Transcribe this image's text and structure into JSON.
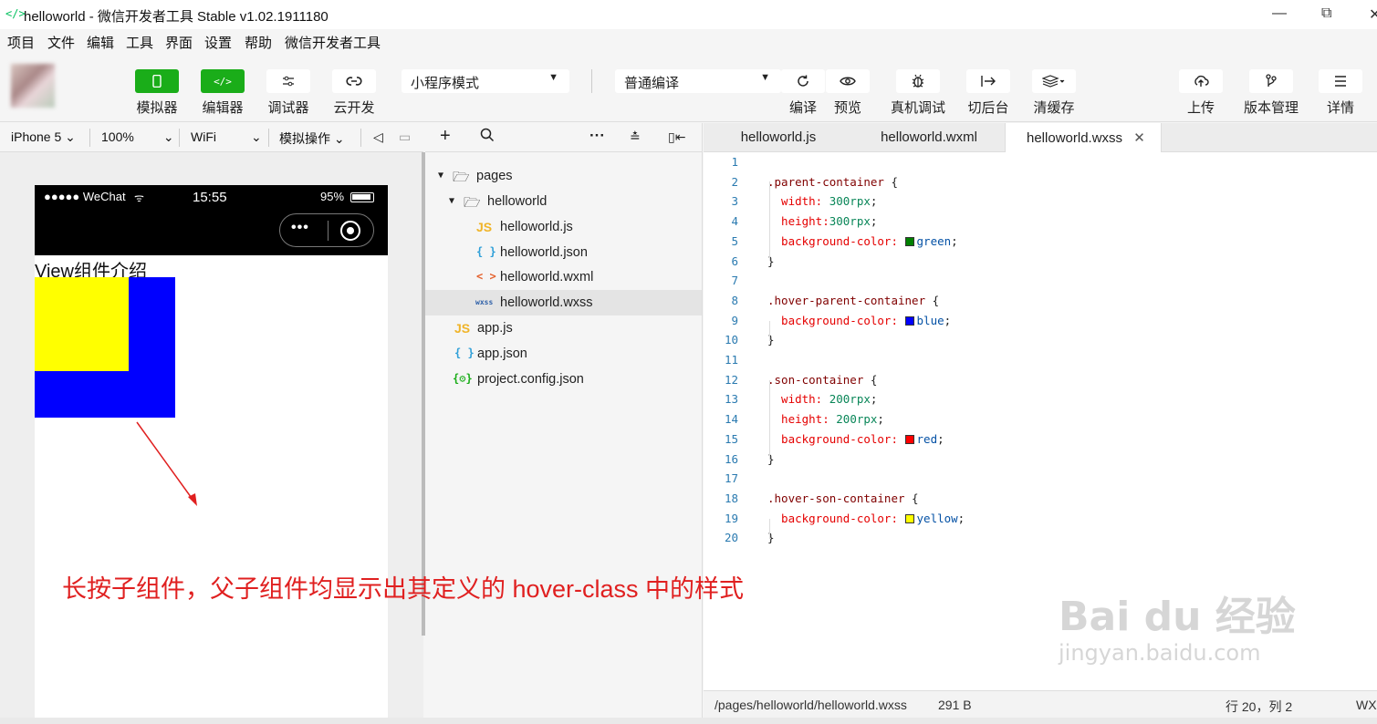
{
  "window": {
    "logo_icon": "code-brackets-icon",
    "logo_glyph": "</>",
    "title": "helloworld - 微信开发者工具 Stable v1.02.1911180",
    "minimize": "—",
    "restore": "⧉",
    "close": "✕"
  },
  "menu": [
    "项目",
    "文件",
    "编辑",
    "工具",
    "界面",
    "设置",
    "帮助",
    "微信开发者工具"
  ],
  "toolbar": {
    "simulator_label": "模拟器",
    "editor_label": "编辑器",
    "debugger_label": "调试器",
    "cloud_label": "云开发",
    "mode_select": "小程序模式",
    "compile_select": "普通编译",
    "compile_label": "编译",
    "preview_label": "预览",
    "realdebug_label": "真机调试",
    "background_label": "切后台",
    "clearcache_label": "清缓存",
    "upload_label": "上传",
    "version_label": "版本管理",
    "details_label": "详情",
    "icons": {
      "simulator": "phone-icon",
      "editor": "code-icon",
      "debugger": "sliders-icon",
      "cloud": "cloud-link-icon",
      "compile": "refresh-icon",
      "preview": "eye-icon",
      "realdebug": "bug-icon",
      "background": "switch-icon",
      "clearcache": "layers-icon",
      "upload": "cloud-upload-icon",
      "version": "branch-icon",
      "details": "menu-icon"
    }
  },
  "simbar": {
    "device": "iPhone 5",
    "zoom": "100%",
    "network": "WiFi",
    "operation": "模拟操作"
  },
  "phone": {
    "signal": "●●●●● WeChat",
    "time": "15:55",
    "battery": "95%",
    "heading": "View组件介绍",
    "parent_color": "#0000ff",
    "son_color": "#ffff00"
  },
  "filetree": {
    "nodes": [
      {
        "label": "pages",
        "type": "folder",
        "level": 0,
        "expanded": true
      },
      {
        "label": "helloworld",
        "type": "folder",
        "level": 1,
        "expanded": true
      },
      {
        "label": "helloworld.js",
        "type": "js",
        "level": 2
      },
      {
        "label": "helloworld.json",
        "type": "json",
        "level": 2
      },
      {
        "label": "helloworld.wxml",
        "type": "wxml",
        "level": 2
      },
      {
        "label": "helloworld.wxss",
        "type": "wxss",
        "level": 2,
        "selected": true
      },
      {
        "label": "app.js",
        "type": "js",
        "level": 1
      },
      {
        "label": "app.json",
        "type": "json",
        "level": 1
      },
      {
        "label": "project.config.json",
        "type": "cfg",
        "level": 1
      }
    ],
    "type_glyphs": {
      "js": "JS",
      "json": "{ }",
      "wxml": "< >",
      "wxss": "wxss",
      "cfg": "{⚙}"
    }
  },
  "tabs": [
    {
      "label": "helloworld.js",
      "active": false
    },
    {
      "label": "helloworld.wxml",
      "active": false
    },
    {
      "label": "helloworld.wxss",
      "active": true
    }
  ],
  "code": {
    "line_numbers": [
      "1",
      "2",
      "3",
      "4",
      "5",
      "6",
      "7",
      "8",
      "9",
      "10",
      "11",
      "12",
      "13",
      "14",
      "15",
      "16",
      "17",
      "18",
      "19",
      "20"
    ],
    "lines": [
      [],
      [
        {
          "t": ".parent-container",
          "c": "sel-c"
        },
        {
          "t": " {",
          "c": "pun"
        }
      ],
      [
        {
          "t": "  width: ",
          "c": "prop"
        },
        {
          "t": "300rpx",
          "c": "num"
        },
        {
          "t": ";",
          "c": "pun"
        }
      ],
      [
        {
          "t": "  height:",
          "c": "prop"
        },
        {
          "t": "300rpx",
          "c": "num"
        },
        {
          "t": ";",
          "c": "pun"
        }
      ],
      [
        {
          "t": "  background-color: ",
          "c": "prop"
        },
        {
          "sw": "#008000"
        },
        {
          "t": "green",
          "c": "val"
        },
        {
          "t": ";",
          "c": "pun"
        }
      ],
      [
        {
          "t": "}",
          "c": "pun"
        }
      ],
      [],
      [
        {
          "t": ".hover-parent-container",
          "c": "sel-c"
        },
        {
          "t": " {",
          "c": "pun"
        }
      ],
      [
        {
          "t": "  background-color: ",
          "c": "prop"
        },
        {
          "sw": "#0000ff"
        },
        {
          "t": "blue",
          "c": "val"
        },
        {
          "t": ";",
          "c": "pun"
        }
      ],
      [
        {
          "t": "}",
          "c": "pun"
        }
      ],
      [],
      [
        {
          "t": ".son-container",
          "c": "sel-c"
        },
        {
          "t": " {",
          "c": "pun"
        }
      ],
      [
        {
          "t": "  width: ",
          "c": "prop"
        },
        {
          "t": "200rpx",
          "c": "num"
        },
        {
          "t": ";",
          "c": "pun"
        }
      ],
      [
        {
          "t": "  height: ",
          "c": "prop"
        },
        {
          "t": "200rpx",
          "c": "num"
        },
        {
          "t": ";",
          "c": "pun"
        }
      ],
      [
        {
          "t": "  background-color: ",
          "c": "prop"
        },
        {
          "sw": "#ff0000"
        },
        {
          "t": "red",
          "c": "val"
        },
        {
          "t": ";",
          "c": "pun"
        }
      ],
      [
        {
          "t": "}",
          "c": "pun"
        }
      ],
      [],
      [
        {
          "t": ".hover-son-container",
          "c": "sel-c"
        },
        {
          "t": " {",
          "c": "pun"
        }
      ],
      [
        {
          "t": "  background-color: ",
          "c": "prop"
        },
        {
          "sw": "#ffff00"
        },
        {
          "t": "yellow",
          "c": "val"
        },
        {
          "t": ";",
          "c": "pun"
        }
      ],
      [
        {
          "t": "}",
          "c": "pun"
        }
      ]
    ]
  },
  "status": {
    "path": "/pages/helloworld/helloworld.wxss",
    "size": "291 B",
    "position": "行 20，列 2",
    "lang": "WX"
  },
  "annotation": "长按子组件，父子组件均显示出其定义的 hover-class 中的样式",
  "watermark": {
    "line1": "Bai du 经验",
    "line2": "jingyan.baidu.com"
  },
  "colors": {
    "accent": "#1aad19",
    "annotation": "#e02020"
  }
}
